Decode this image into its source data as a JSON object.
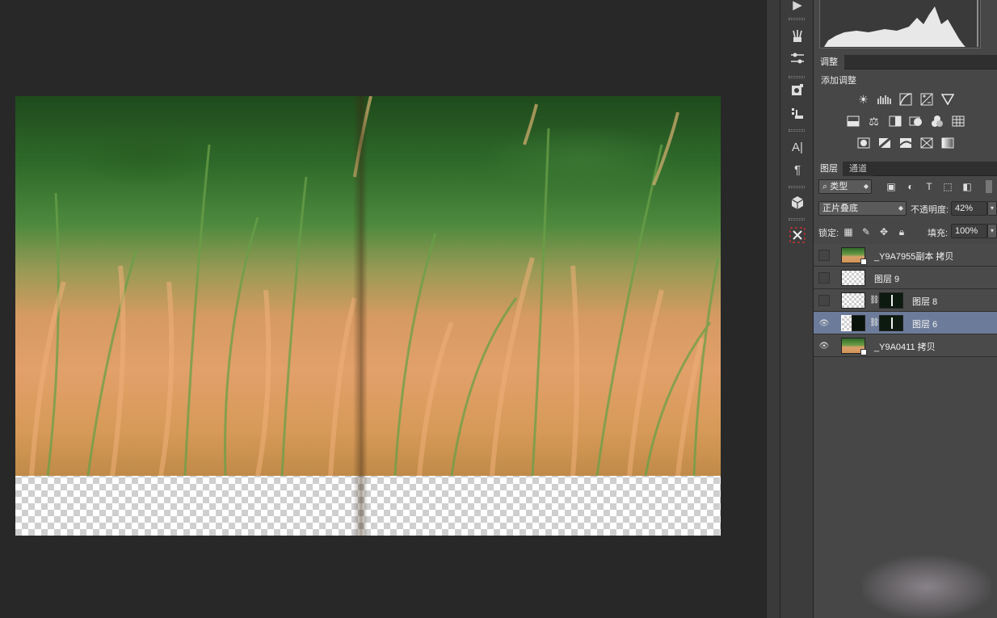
{
  "panels": {
    "adjustments": {
      "tab_label": "调整",
      "title": "添加调整",
      "rows": [
        [
          "brightness-icon",
          "levels-icon",
          "curves-icon",
          "exposure-icon",
          "vibrance-icon"
        ],
        [
          "hue-saturation-icon",
          "color-balance-icon",
          "black-white-icon",
          "photo-filter-icon",
          "channel-mixer-icon",
          "color-lookup-icon"
        ],
        [
          "invert-icon",
          "posterize-icon",
          "threshold-icon",
          "selective-color-icon",
          "gradient-map-icon"
        ]
      ]
    },
    "layers": {
      "tabs": [
        "图层",
        "通道"
      ],
      "filter_kind": "类型",
      "blend_mode": "正片叠底",
      "opacity_label": "不透明度:",
      "opacity_value": "42%",
      "lock_label": "锁定:",
      "fill_label": "填充:",
      "fill_value": "100%",
      "items": [
        {
          "name": "_Y9A7955副本 拷贝",
          "visible": false,
          "selected": false
        },
        {
          "name": "图层 9",
          "visible": false,
          "selected": false
        },
        {
          "name": "图层 8",
          "visible": false,
          "selected": false
        },
        {
          "name": "图层 6",
          "visible": true,
          "selected": true
        },
        {
          "name": "_Y9A0411 拷贝",
          "visible": true,
          "selected": false
        }
      ]
    }
  },
  "toolstrip": [
    "play-icon",
    "brushes-icon",
    "brush-presets-icon",
    "clone-source-icon",
    "tool-presets-icon",
    "character-icon",
    "paragraph-icon",
    "3d-icon",
    "transform-icon"
  ],
  "colors": {
    "selected_layer": "#6c7b99",
    "panel_bg": "#474747",
    "canvas_bg": "#282828"
  }
}
